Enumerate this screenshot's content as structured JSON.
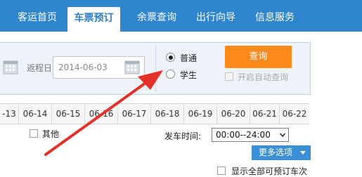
{
  "nav": {
    "items": [
      {
        "label": "客运首页",
        "active": false
      },
      {
        "label": "车票预订",
        "active": true
      },
      {
        "label": "余票查询",
        "active": false
      },
      {
        "label": "出行向导",
        "active": false
      },
      {
        "label": "信息服务",
        "active": false
      }
    ]
  },
  "query": {
    "return_label": "返程日",
    "return_date": "2014-06-03",
    "passenger_types": [
      {
        "label": "普通",
        "selected": true
      },
      {
        "label": "学生",
        "selected": false
      }
    ],
    "query_button": "查询",
    "auto_query_label": "开启自动查询",
    "auto_query_enabled": false
  },
  "dates": [
    "-13",
    "06-14",
    "06-15",
    "06-16",
    "06-17",
    "06-18",
    "06-19",
    "06-20",
    "06-21",
    "06-22"
  ],
  "filters": {
    "other_label": "其他",
    "depart_time_label": "发车时间:",
    "depart_time_value": "00:00--24:00",
    "more_options": "更多选项",
    "show_all_label": "显示全部可预订车次"
  },
  "colors": {
    "nav_bg": "#2f86cf",
    "accent": "#ff8a1c",
    "annotation_arrow": "#e4322b"
  }
}
